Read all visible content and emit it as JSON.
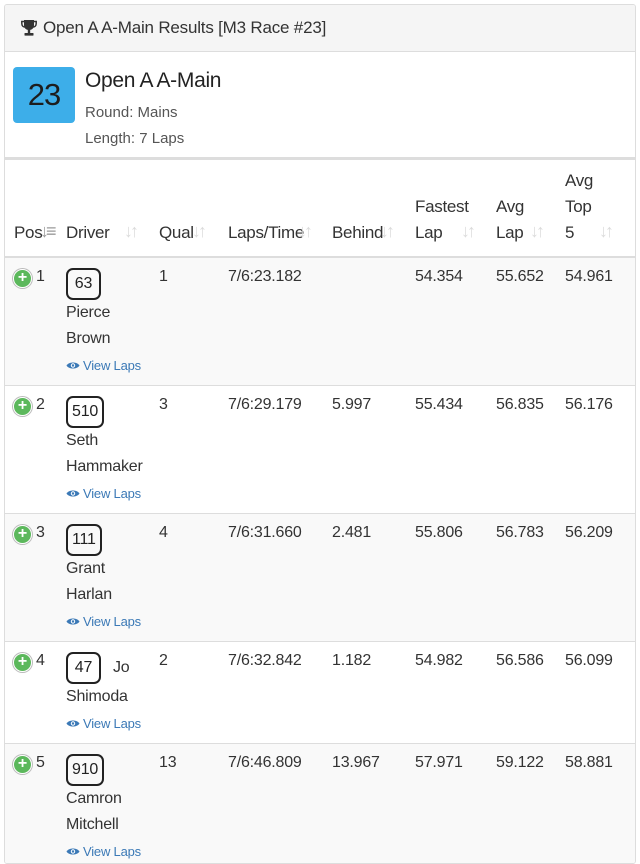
{
  "panel": {
    "title": "Open A A-Main Results [M3 Race #23]"
  },
  "race": {
    "number": "23",
    "name": "Open A A-Main",
    "round": "Round: Mains",
    "length": "Length: 7 Laps"
  },
  "table": {
    "headers": {
      "pos": "Pos",
      "driver": "Driver",
      "qual": "Qual",
      "laps_time": "Laps/Time",
      "behind": "Behind",
      "fastest_lap_1": "Fastest",
      "fastest_lap_2": "Lap",
      "avg_lap_1": "Avg",
      "avg_lap_2": "Lap",
      "avg_top5_1": "Avg",
      "avg_top5_2": "Top",
      "avg_top5_3": "5"
    },
    "view_laps_label": "View Laps",
    "rows": [
      {
        "pos": "1",
        "num": "63",
        "first": "Pierce",
        "last": "Brown",
        "qual": "1",
        "laps_time": "7/6:23.182",
        "behind": "",
        "fastest": "54.354",
        "avg": "55.652",
        "top5": "54.961"
      },
      {
        "pos": "2",
        "num": "510",
        "first": "Seth",
        "last": "Hammaker",
        "qual": "3",
        "laps_time": "7/6:29.179",
        "behind": "5.997",
        "fastest": "55.434",
        "avg": "56.835",
        "top5": "56.176"
      },
      {
        "pos": "3",
        "num": "111",
        "first": "Grant",
        "last": "Harlan",
        "qual": "4",
        "laps_time": "7/6:31.660",
        "behind": "2.481",
        "fastest": "55.806",
        "avg": "56.783",
        "top5": "56.209"
      },
      {
        "pos": "4",
        "num": "47",
        "first": "Jo",
        "last": "Shimoda",
        "qual": "2",
        "laps_time": "7/6:32.842",
        "behind": "1.182",
        "fastest": "54.982",
        "avg": "56.586",
        "top5": "56.099"
      },
      {
        "pos": "5",
        "num": "910",
        "first": "Camron",
        "last": "Mitchell",
        "qual": "13",
        "laps_time": "7/6:46.809",
        "behind": "13.967",
        "fastest": "57.971",
        "avg": "59.122",
        "top5": "58.881"
      }
    ]
  },
  "colors": {
    "badge": "#3daee9",
    "link": "#3b79b6",
    "expand": "#5cb85c"
  }
}
